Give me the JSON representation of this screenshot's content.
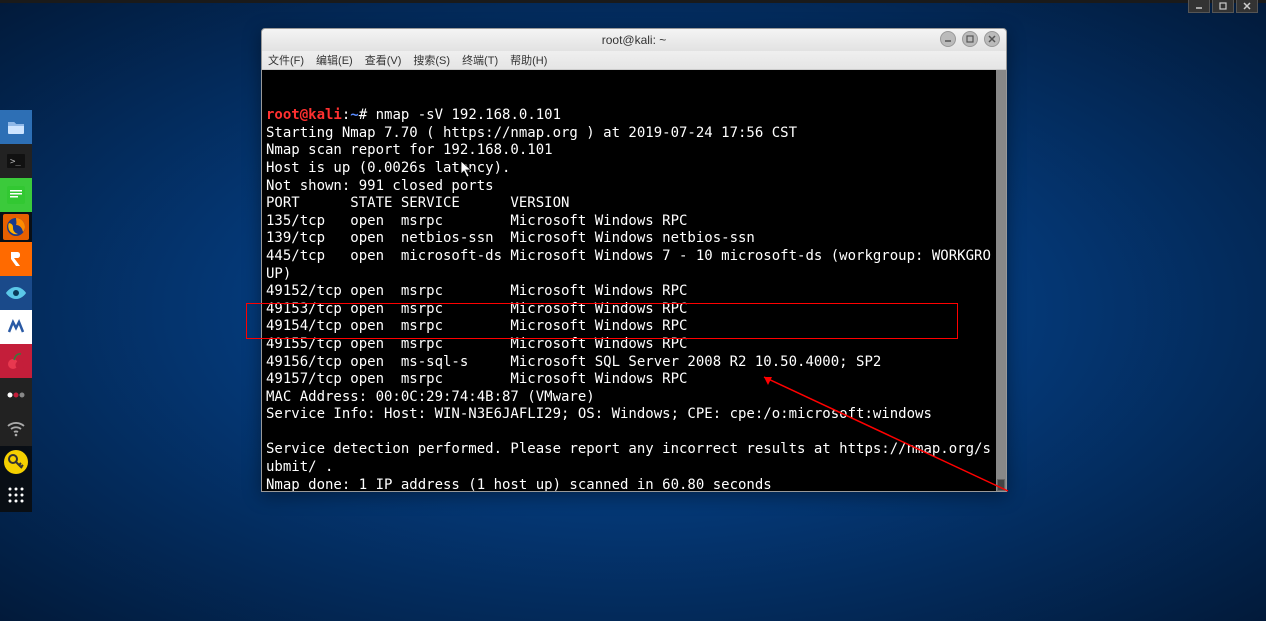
{
  "window": {
    "title": "root@kali: ~",
    "menu": {
      "file": "文件(F)",
      "edit": "编辑(E)",
      "view": "查看(V)",
      "search": "搜索(S)",
      "terminal": "终端(T)",
      "help": "帮助(H)"
    }
  },
  "prompt": {
    "user_host": "root@kali",
    "sep": ":",
    "path": "~",
    "end": "#"
  },
  "cmd": {
    "nmap": " nmap -sV 192.168.0.101"
  },
  "out": {
    "l1": "Starting Nmap 7.70 ( https://nmap.org ) at 2019-07-24 17:56 CST",
    "l2": "Nmap scan report for 192.168.0.101",
    "l3": "Host is up (0.0026s latency).",
    "l4": "Not shown: 991 closed ports",
    "l5": "PORT      STATE SERVICE      VERSION",
    "l6": "135/tcp   open  msrpc        Microsoft Windows RPC",
    "l7": "139/tcp   open  netbios-ssn  Microsoft Windows netbios-ssn",
    "l8": "445/tcp   open  microsoft-ds Microsoft Windows 7 - 10 microsoft-ds (workgroup: WORKGROUP)",
    "l9": "49152/tcp open  msrpc        Microsoft Windows RPC",
    "l10": "49153/tcp open  msrpc        Microsoft Windows RPC",
    "l11": "49154/tcp open  msrpc        Microsoft Windows RPC",
    "l12": "49155/tcp open  msrpc        Microsoft Windows RPC",
    "l13": "49156/tcp open  ms-sql-s     Microsoft SQL Server 2008 R2 10.50.4000; SP2",
    "l14": "49157/tcp open  msrpc        Microsoft Windows RPC",
    "l15": "MAC Address: 00:0C:29:74:4B:87 (VMware)",
    "l16": "Service Info: Host: WIN-N3E6JAFLI29; OS: Windows; CPE: cpe:/o:microsoft:windows",
    "l17": "Service detection performed. Please report any incorrect results at https://nmap.org/submit/ .",
    "l18": "Nmap done: 1 IP address (1 host up) scanned in 60.80 seconds",
    "blank": " "
  },
  "dock": {
    "files": "files-manager",
    "terminal": "terminal",
    "editor": "text-editor",
    "firefox": "firefox",
    "burp": "burpsuite",
    "eye": "recon",
    "maltego": "maltego",
    "cherry": "cherrytree",
    "ooo": "generic",
    "wifi": "wireless",
    "key": "passwords",
    "grid": "all-apps"
  }
}
